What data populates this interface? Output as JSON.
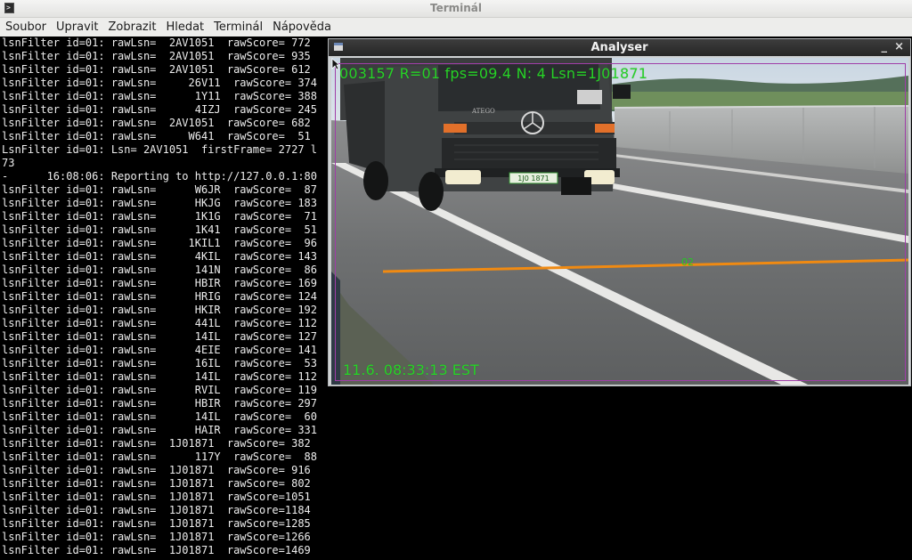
{
  "window": {
    "title": "Terminál",
    "icon": "terminal-icon"
  },
  "menubar": {
    "items": [
      "Soubor",
      "Upravit",
      "Zobrazit",
      "Hledat",
      "Terminál",
      "Nápověda"
    ]
  },
  "terminal": {
    "lines": [
      "lsnFilter id=01: rawLsn=  2AV1051  rawScore= 772",
      "lsnFilter id=01: rawLsn=  2AV1051  rawScore= 935",
      "lsnFilter id=01: rawLsn=  2AV1051  rawScore= 612",
      "lsnFilter id=01: rawLsn=     26V11  rawScore= 374",
      "lsnFilter id=01: rawLsn=      1Y11  rawScore= 388",
      "lsnFilter id=01: rawLsn=      4IZJ  rawScore= 245",
      "lsnFilter id=01: rawLsn=  2AV1051  rawScore= 682",
      "lsnFilter id=01: rawLsn=     W641  rawScore=  51",
      "LsnFilter id=01: Lsn= 2AV1051  firstFrame= 2727 l",
      "73",
      "-      16:08:06: Reporting to http://127.0.0.1:80",
      "lsnFilter id=01: rawLsn=      W6JR  rawScore=  87",
      "lsnFilter id=01: rawLsn=      HKJG  rawScore= 183",
      "lsnFilter id=01: rawLsn=      1K1G  rawScore=  71",
      "lsnFilter id=01: rawLsn=      1K41  rawScore=  51",
      "lsnFilter id=01: rawLsn=     1KIL1  rawScore=  96",
      "lsnFilter id=01: rawLsn=      4KIL  rawScore= 143",
      "lsnFilter id=01: rawLsn=      141N  rawScore=  86",
      "lsnFilter id=01: rawLsn=      HBIR  rawScore= 169",
      "lsnFilter id=01: rawLsn=      HRIG  rawScore= 124",
      "lsnFilter id=01: rawLsn=      HKIR  rawScore= 192",
      "lsnFilter id=01: rawLsn=      441L  rawScore= 112",
      "lsnFilter id=01: rawLsn=      14IL  rawScore= 127",
      "lsnFilter id=01: rawLsn=      4EIE  rawScore= 141",
      "lsnFilter id=01: rawLsn=      16IL  rawScore=  53",
      "lsnFilter id=01: rawLsn=      14IL  rawScore= 112",
      "lsnFilter id=01: rawLsn=      RVIL  rawScore= 119",
      "lsnFilter id=01: rawLsn=      HBIR  rawScore= 297",
      "lsnFilter id=01: rawLsn=      14IL  rawScore=  60",
      "lsnFilter id=01: rawLsn=      HAIR  rawScore= 331",
      "lsnFilter id=01: rawLsn=  1J01871  rawScore= 382",
      "lsnFilter id=01: rawLsn=      117Y  rawScore=  88",
      "lsnFilter id=01: rawLsn=  1J01871  rawScore= 916",
      "lsnFilter id=01: rawLsn=  1J01871  rawScore= 802",
      "lsnFilter id=01: rawLsn=  1J01871  rawScore=1051",
      "lsnFilter id=01: rawLsn=  1J01871  rawScore=1184",
      "lsnFilter id=01: rawLsn=  1J01871  rawScore=1285",
      "lsnFilter id=01: rawLsn=  1J01871  rawScore=1266",
      "lsnFilter id=01: rawLsn=  1J01871  rawScore=1469"
    ]
  },
  "analyser": {
    "title": "Analyser",
    "minimize": "_",
    "close": "×",
    "hud_top": "003157 R=01  fps=09.4  N: 4  Lsn=1J01871",
    "hud_bottom": "11.6. 08:33:13 EST",
    "roi_label": "02",
    "plate_text": "1J0 1871",
    "brand_text": "ATEGO"
  },
  "colors": {
    "overlay_text": "#27d327",
    "detection_line": "#f08a12",
    "roi_frame": "#a03ea8",
    "terminal_bg": "#000000",
    "terminal_fg": "#ededed"
  }
}
